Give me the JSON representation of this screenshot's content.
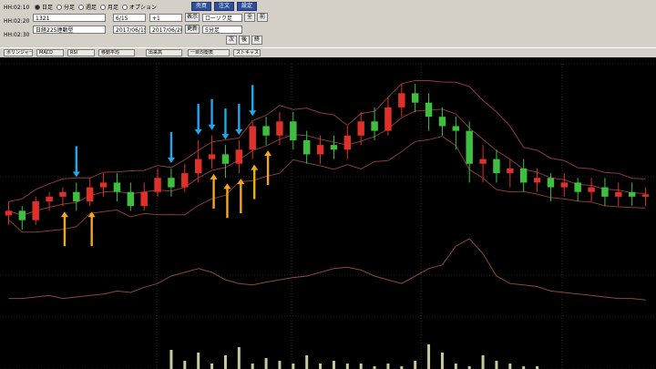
{
  "toolbar": {
    "clocks": [
      "HH:02:10",
      "HH:02:20",
      "HH:02:30"
    ],
    "radios": [
      {
        "label": "日足",
        "on": true
      },
      {
        "label": "分足",
        "on": false
      },
      {
        "label": "週足",
        "on": false
      },
      {
        "label": "月足",
        "on": false
      },
      {
        "label": "オプション",
        "on": false
      }
    ],
    "symbol_field": "1321",
    "market_field": "日経225連動型",
    "input_b1": "6/15",
    "input_b2": "2017/06/15",
    "input_c1": "+1",
    "input_c2": "2017/06/20",
    "btn_show": "表示",
    "btn_update": "更新",
    "btn_blue1": "売買",
    "btn_blue2": "注文",
    "btn_blue3": "設定",
    "right_input1": "ローソク足",
    "right_input2": "5分足",
    "btn_r1": "全",
    "btn_r2": "前",
    "btn_r3": "次",
    "btn_r4": "後",
    "btn_r5": "終"
  },
  "indicator_tabs": [
    "ボリンジャーバンド",
    "MACD",
    "RSI",
    "移動平均",
    "出来高",
    "一目均衡表",
    "ストキャス"
  ],
  "colors": {
    "background": "#000000",
    "bull_candle": "#e0302a",
    "bear_candle": "#3fbf3f",
    "band": "#8a3a3a",
    "grid": "#4a4a4a",
    "lower_line": "#8a4a3a",
    "volume": "#c8c8a0",
    "arrow_down": "#20a8ec",
    "arrow_up": "#f2a818"
  },
  "chart_data": [
    {
      "type": "line",
      "candles": [
        [
          0,
          50.5,
          50.6,
          50.3,
          50.8
        ],
        [
          1,
          50.6,
          50.4,
          50.2,
          50.7
        ],
        [
          2,
          50.4,
          50.8,
          50.3,
          50.9
        ],
        [
          3,
          50.8,
          50.9,
          50.6,
          51.0
        ],
        [
          4,
          50.9,
          51.0,
          50.7,
          51.1
        ],
        [
          5,
          51.0,
          50.8,
          50.6,
          51.2
        ],
        [
          6,
          50.8,
          51.1,
          50.7,
          51.3
        ],
        [
          7,
          51.1,
          51.2,
          50.9,
          51.4
        ],
        [
          8,
          51.2,
          51.0,
          50.8,
          51.4
        ],
        [
          9,
          51.0,
          50.7,
          50.6,
          51.2
        ],
        [
          10,
          50.7,
          51.0,
          50.6,
          51.2
        ],
        [
          11,
          51.0,
          51.3,
          50.9,
          51.5
        ],
        [
          12,
          51.3,
          51.1,
          50.9,
          51.5
        ],
        [
          13,
          51.1,
          51.4,
          51.0,
          51.6
        ],
        [
          14,
          51.4,
          51.7,
          51.2,
          52.1
        ],
        [
          15,
          51.7,
          51.8,
          51.5,
          52.2
        ],
        [
          16,
          51.8,
          51.6,
          51.3,
          52.0
        ],
        [
          17,
          51.6,
          51.9,
          51.4,
          52.1
        ],
        [
          18,
          51.9,
          52.4,
          51.7,
          52.5
        ],
        [
          19,
          52.4,
          52.2,
          52.0,
          52.6
        ],
        [
          20,
          52.2,
          52.5,
          52.0,
          52.7
        ],
        [
          21,
          52.5,
          52.1,
          51.9,
          52.7
        ],
        [
          22,
          52.1,
          51.8,
          51.6,
          52.3
        ],
        [
          23,
          51.8,
          52.0,
          51.6,
          52.2
        ],
        [
          24,
          52.0,
          51.9,
          51.7,
          52.2
        ],
        [
          25,
          51.9,
          52.2,
          51.7,
          52.4
        ],
        [
          26,
          52.2,
          52.5,
          52.0,
          52.7
        ],
        [
          27,
          52.5,
          52.3,
          52.1,
          52.8
        ],
        [
          28,
          52.3,
          52.8,
          52.2,
          53.0
        ],
        [
          29,
          52.8,
          53.1,
          52.6,
          53.3
        ],
        [
          30,
          53.1,
          52.9,
          52.7,
          53.3
        ],
        [
          31,
          52.9,
          52.6,
          52.3,
          53.1
        ],
        [
          32,
          52.6,
          52.4,
          52.2,
          52.8
        ],
        [
          33,
          52.4,
          52.3,
          51.9,
          52.6
        ],
        [
          34,
          52.3,
          51.6,
          51.2,
          52.5
        ],
        [
          35,
          51.6,
          51.7,
          51.2,
          52.0
        ],
        [
          36,
          51.7,
          51.4,
          51.2,
          51.9
        ],
        [
          37,
          51.4,
          51.5,
          51.1,
          51.7
        ],
        [
          38,
          51.5,
          51.2,
          51.0,
          51.7
        ],
        [
          39,
          51.2,
          51.3,
          51.0,
          51.5
        ],
        [
          40,
          51.3,
          51.1,
          50.8,
          51.4
        ],
        [
          41,
          51.1,
          51.2,
          50.9,
          51.4
        ],
        [
          42,
          51.2,
          51.0,
          50.8,
          51.3
        ],
        [
          43,
          51.0,
          51.1,
          50.8,
          51.3
        ],
        [
          44,
          51.1,
          50.9,
          50.7,
          51.3
        ],
        [
          45,
          50.9,
          51.0,
          50.7,
          51.2
        ],
        [
          46,
          51.0,
          50.9,
          50.7,
          51.2
        ],
        [
          47,
          50.9,
          50.95,
          50.7,
          51.1
        ]
      ],
      "down_arrows": [
        5,
        12,
        14,
        15,
        16,
        17,
        18
      ],
      "up_arrows": [
        4,
        6,
        15,
        16,
        17,
        18,
        19
      ]
    },
    {
      "type": "line",
      "values": [
        0.2,
        0.2,
        0.22,
        0.24,
        0.2,
        0.22,
        0.24,
        0.26,
        0.3,
        0.28,
        0.35,
        0.4,
        0.5,
        0.55,
        0.6,
        0.55,
        0.45,
        0.4,
        0.38,
        0.42,
        0.45,
        0.48,
        0.5,
        0.55,
        0.6,
        0.62,
        0.58,
        0.5,
        0.45,
        0.4,
        0.5,
        0.6,
        0.65,
        0.9,
        1.0,
        0.8,
        0.5,
        0.4,
        0.38,
        0.36,
        0.3,
        0.28,
        0.26,
        0.24,
        0.22,
        0.2,
        0.2,
        0.18
      ]
    },
    {
      "type": "bar",
      "values": [
        0,
        0,
        0,
        0,
        0,
        0,
        0,
        0,
        0,
        0,
        0,
        0,
        0.7,
        0.3,
        0.6,
        0.2,
        0.5,
        0.8,
        0.2,
        0.4,
        0.3,
        0.2,
        0.5,
        0.2,
        0.3,
        0.2,
        0.2,
        0.1,
        0.2,
        0.1,
        0.3,
        0.9,
        0.6,
        0.2,
        0.1,
        0.5,
        0.3,
        0.2,
        0.1,
        0.1,
        0,
        0,
        0,
        0,
        0,
        0,
        0,
        0
      ]
    }
  ]
}
